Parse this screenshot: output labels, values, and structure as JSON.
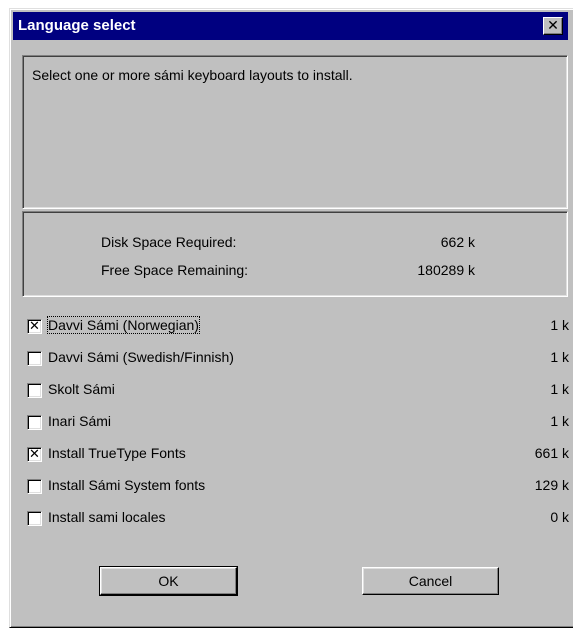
{
  "window": {
    "title": "Language select",
    "close_label": "✕"
  },
  "description": "Select one or more sámi keyboard layouts to install.",
  "space": {
    "required_label": "Disk Space Required:",
    "required_value": "662 k",
    "free_label": "Free Space Remaining:",
    "free_value": "180289 k"
  },
  "items": [
    {
      "label": "Davvi Sámi (Norwegian)",
      "size": "1 k",
      "checked": true
    },
    {
      "label": "Davvi Sámi (Swedish/Finnish)",
      "size": "1 k",
      "checked": false
    },
    {
      "label": "Skolt Sámi",
      "size": "1 k",
      "checked": false
    },
    {
      "label": "Inari Sámi",
      "size": "1 k",
      "checked": false
    },
    {
      "label": "Install TrueType Fonts",
      "size": "661 k",
      "checked": true
    },
    {
      "label": "Install Sámi System fonts",
      "size": "129 k",
      "checked": false
    },
    {
      "label": "Install sami locales",
      "size": "0 k",
      "checked": false
    }
  ],
  "buttons": {
    "ok": "OK",
    "cancel": "Cancel"
  },
  "colors": {
    "titlebar": "#000080",
    "face": "#c0c0c0"
  },
  "icons": {
    "checkmark": "check-icon",
    "close": "close-icon"
  }
}
